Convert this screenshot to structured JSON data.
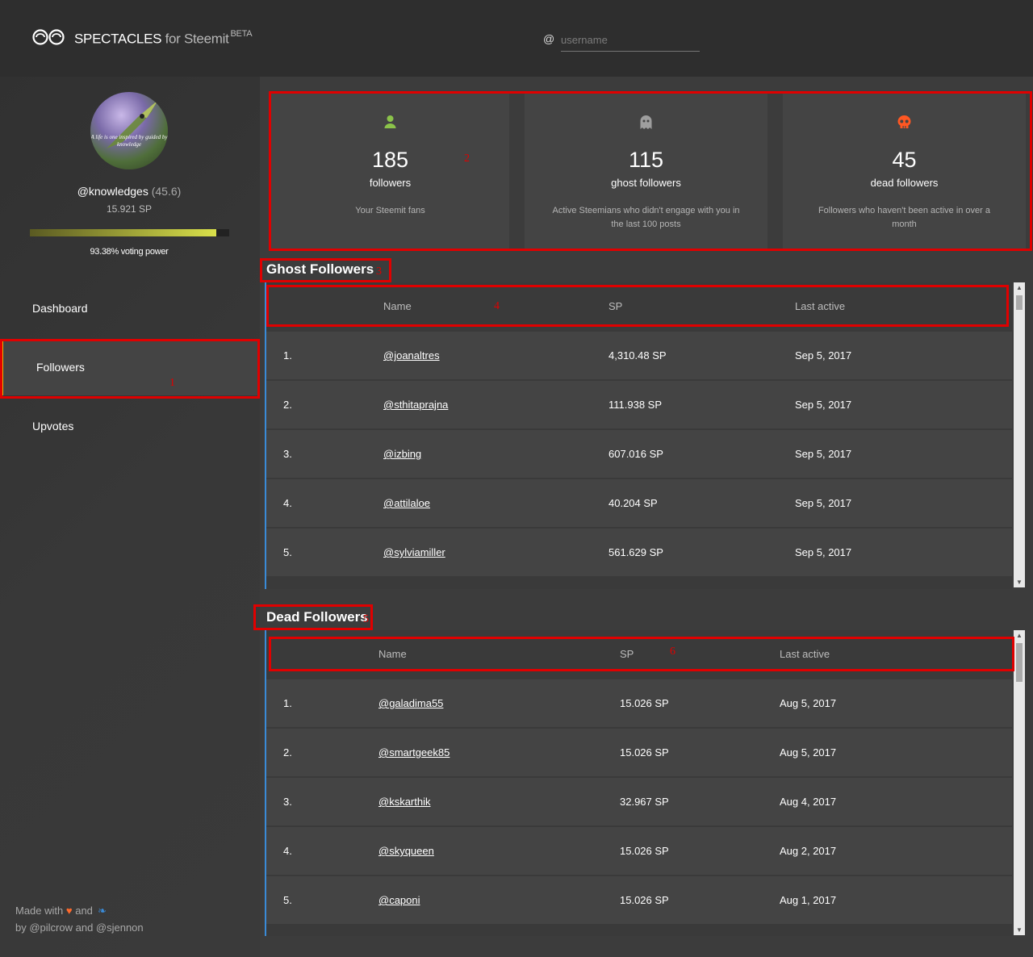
{
  "header": {
    "brand": "SPECTACLES",
    "brand_sub": "for Steemit",
    "beta": "BETA",
    "at_symbol": "@",
    "search_placeholder": "username"
  },
  "profile": {
    "username": "@knowledges",
    "reputation": "(45.6)",
    "sp": "15.921 SP",
    "voting_power_label": "93.38% voting power",
    "voting_power_fraction": 0.9338,
    "avatar_caption": "A life is one inspired by guided by knowledge"
  },
  "nav": {
    "items": [
      {
        "label": "Dashboard"
      },
      {
        "label": "Followers",
        "active": true
      },
      {
        "label": "Upvotes"
      }
    ]
  },
  "footer": {
    "made_with": "Made with",
    "and": "and",
    "by": "by @pilcrow and @sjennon"
  },
  "stats": [
    {
      "icon": "person-icon",
      "color": "#8bc34a",
      "number": "185",
      "label": "followers",
      "desc": "Your Steemit fans"
    },
    {
      "icon": "ghost-icon",
      "color": "#9e9e9e",
      "number": "115",
      "label": "ghost followers",
      "desc": "Active Steemians who didn't engage with you in the last 100 posts"
    },
    {
      "icon": "skull-icon",
      "color": "#ff5722",
      "number": "45",
      "label": "dead followers",
      "desc": "Followers who haven't been active in over a month"
    }
  ],
  "annotations": [
    "1",
    "2",
    "3",
    "4",
    "5",
    "6"
  ],
  "ghost": {
    "title": "Ghost Followers",
    "headers": {
      "name": "Name",
      "sp": "SP",
      "last": "Last active"
    },
    "rows": [
      {
        "idx": "1.",
        "name": "@joanaltres",
        "sp": "4,310.48 SP",
        "last": "Sep 5, 2017"
      },
      {
        "idx": "2.",
        "name": "@sthitaprajna",
        "sp": "111.938 SP",
        "last": "Sep 5, 2017"
      },
      {
        "idx": "3.",
        "name": "@izbing",
        "sp": "607.016 SP",
        "last": "Sep 5, 2017"
      },
      {
        "idx": "4.",
        "name": "@attilaloe",
        "sp": "40.204 SP",
        "last": "Sep 5, 2017"
      },
      {
        "idx": "5.",
        "name": "@sylviamiller",
        "sp": "561.629 SP",
        "last": "Sep 5, 2017"
      }
    ]
  },
  "dead": {
    "title": "Dead Followers",
    "headers": {
      "name": "Name",
      "sp": "SP",
      "last": "Last active"
    },
    "rows": [
      {
        "idx": "1.",
        "name": "@galadima55",
        "sp": "15.026 SP",
        "last": "Aug 5, 2017"
      },
      {
        "idx": "2.",
        "name": "@smartgeek85",
        "sp": "15.026 SP",
        "last": "Aug 5, 2017"
      },
      {
        "idx": "3.",
        "name": "@kskarthik",
        "sp": "32.967 SP",
        "last": "Aug 4, 2017"
      },
      {
        "idx": "4.",
        "name": "@skyqueen",
        "sp": "15.026 SP",
        "last": "Aug 2, 2017"
      },
      {
        "idx": "5.",
        "name": "@caponi",
        "sp": "15.026 SP",
        "last": "Aug 1, 2017"
      }
    ]
  }
}
